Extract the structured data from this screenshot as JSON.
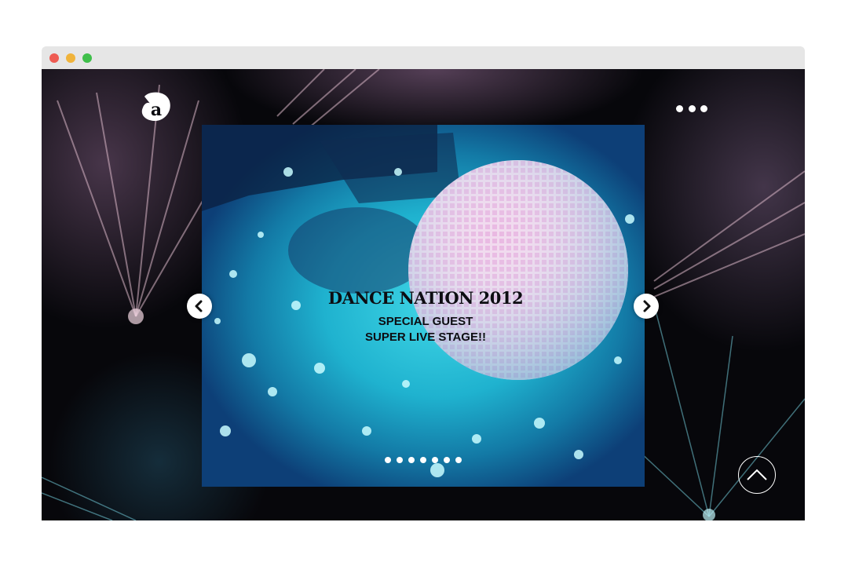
{
  "window": {
    "controls": [
      "close",
      "minimize",
      "maximize"
    ]
  },
  "header": {
    "logo_icon": "a-logo-icon",
    "menu_icon": "more-dots-icon"
  },
  "slider": {
    "headline": "DANCE NATION 2012",
    "subline_1": "SPECIAL GUEST",
    "subline_2": "SUPER LIVE STAGE!!",
    "prev_icon": "chevron-left-icon",
    "next_icon": "chevron-right-icon",
    "page_count": 7,
    "current_page": 1
  },
  "scroll_top": {
    "icon": "chevron-up-icon"
  },
  "colors": {
    "titlebar": "#e6e6e6",
    "close": "#ee5b52",
    "minimize": "#f0b33b",
    "maximize": "#3fbf4a",
    "slide_cyan": "#1fb2cf",
    "text": "#0d0d12"
  }
}
